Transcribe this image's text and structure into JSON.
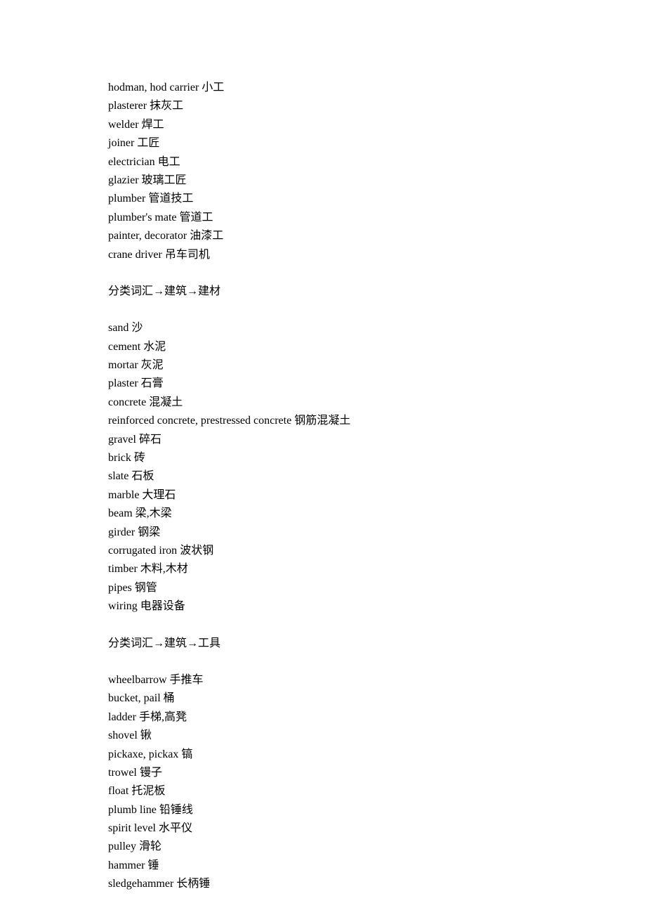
{
  "sections": [
    {
      "heading": null,
      "entries": [
        {
          "en": "hodman, hod carrier",
          "zh": "小工"
        },
        {
          "en": "plasterer",
          "zh": "抹灰工"
        },
        {
          "en": "welder",
          "zh": "焊工"
        },
        {
          "en": "joiner",
          "zh": "工匠"
        },
        {
          "en": "electrician",
          "zh": "电工"
        },
        {
          "en": "glazier",
          "zh": "玻璃工匠"
        },
        {
          "en": "plumber",
          "zh": "管道技工"
        },
        {
          "en": "plumber's mate",
          "zh": "管道工"
        },
        {
          "en": "painter, decorator",
          "zh": "油漆工"
        },
        {
          "en": "crane driver",
          "zh": "吊车司机"
        }
      ]
    },
    {
      "heading": "分类词汇→建筑→建材",
      "entries": [
        {
          "en": "sand",
          "zh": "沙"
        },
        {
          "en": "cement",
          "zh": "水泥"
        },
        {
          "en": "mortar",
          "zh": "灰泥"
        },
        {
          "en": "plaster",
          "zh": "石膏"
        },
        {
          "en": "concrete",
          "zh": "混凝土"
        },
        {
          "en": "reinforced concrete, prestressed concrete",
          "zh": "钢筋混凝土"
        },
        {
          "en": "gravel",
          "zh": "碎石"
        },
        {
          "en": "brick",
          "zh": "砖"
        },
        {
          "en": "slate",
          "zh": "石板"
        },
        {
          "en": "marble",
          "zh": "大理石"
        },
        {
          "en": "beam",
          "zh": "梁,木梁"
        },
        {
          "en": "girder",
          "zh": "钢梁"
        },
        {
          "en": "corrugated iron",
          "zh": "波状钢"
        },
        {
          "en": "timber",
          "zh": "木料,木材"
        },
        {
          "en": "pipes",
          "zh": "钢管"
        },
        {
          "en": "wiring",
          "zh": "电器设备"
        }
      ]
    },
    {
      "heading": "分类词汇→建筑→工具",
      "entries": [
        {
          "en": "wheelbarrow",
          "zh": "手推车"
        },
        {
          "en": "bucket, pail",
          "zh": "桶"
        },
        {
          "en": "ladder",
          "zh": "手梯,高凳"
        },
        {
          "en": "shovel",
          "zh": "锹"
        },
        {
          "en": "pickaxe, pickax",
          "zh": "镐"
        },
        {
          "en": "trowel",
          "zh": "镘子"
        },
        {
          "en": "float",
          "zh": "托泥板"
        },
        {
          "en": "plumb line",
          "zh": "铅锤线"
        },
        {
          "en": "spirit level",
          "zh": "水平仪"
        },
        {
          "en": "pulley",
          "zh": "滑轮"
        },
        {
          "en": "hammer",
          "zh": "锤"
        },
        {
          "en": "sledgehammer",
          "zh": "长柄锤"
        }
      ]
    }
  ]
}
